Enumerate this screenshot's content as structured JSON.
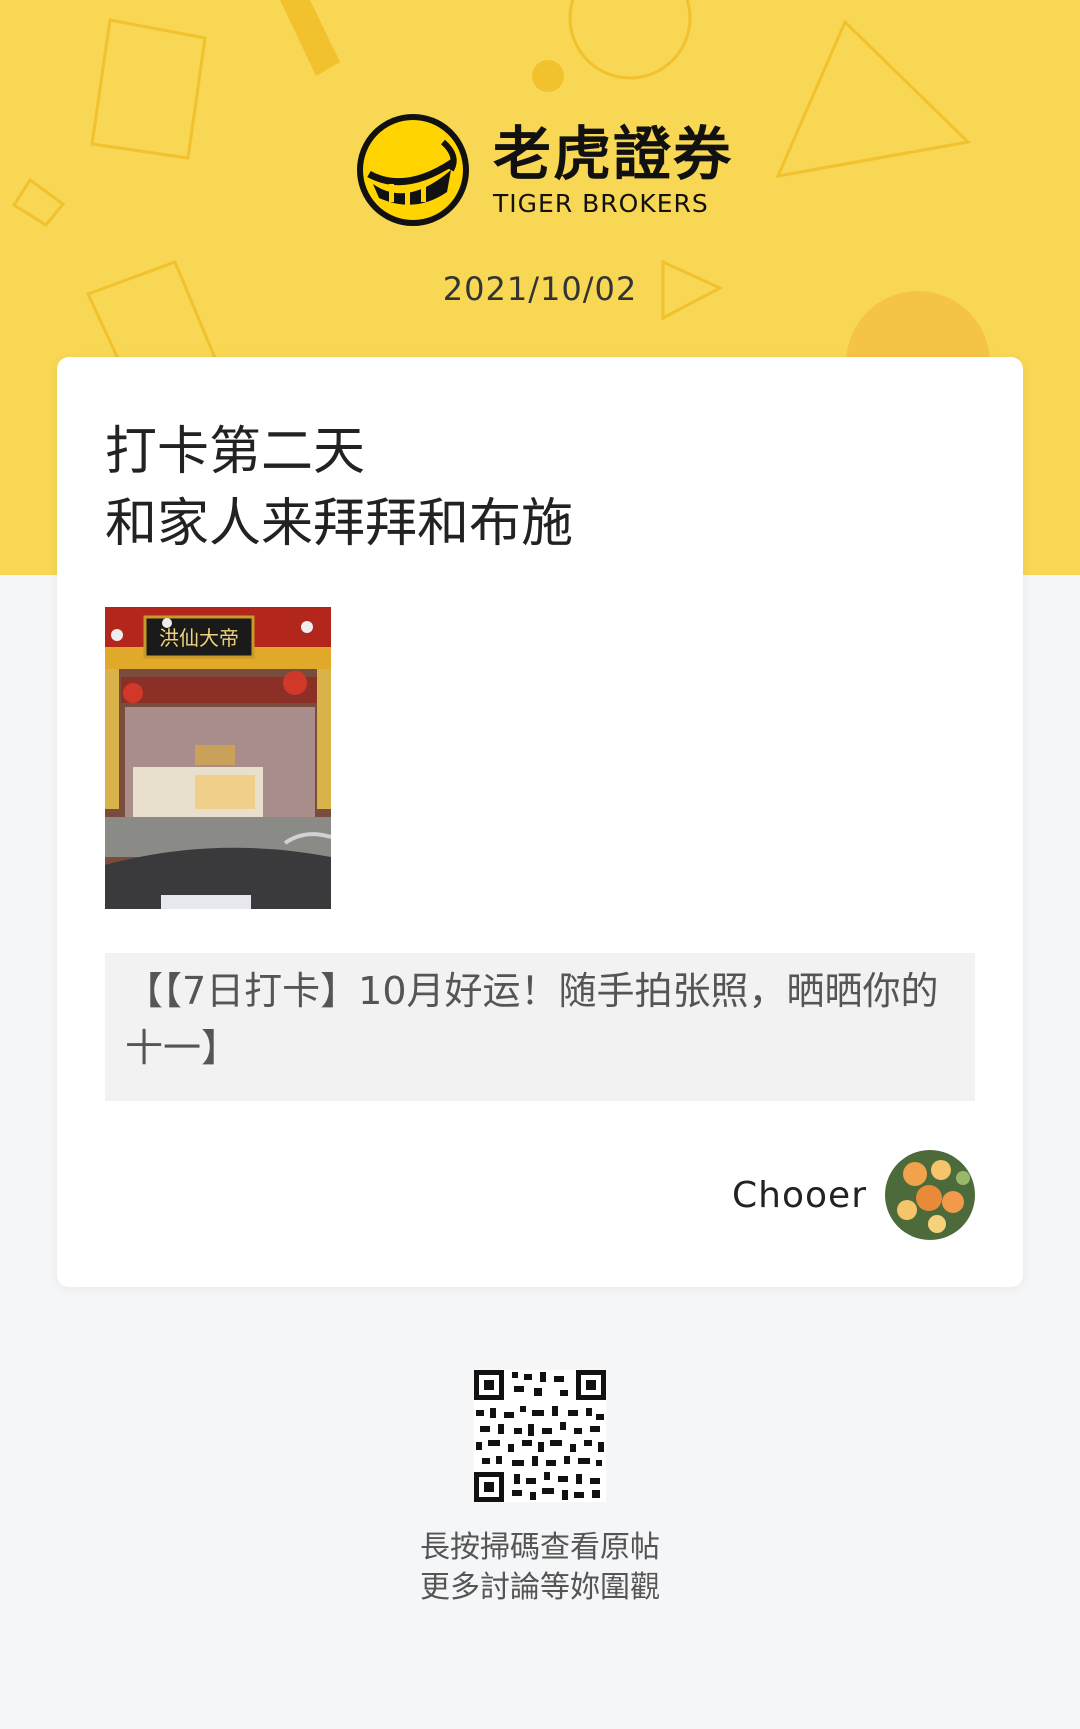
{
  "header": {
    "brand_cn": "老虎證券",
    "brand_en": "TIGER BROKERS",
    "date": "2021/10/02"
  },
  "post": {
    "line1": "打卡第二天",
    "line2": "和家人来拜拜和布施",
    "photo_sign": "洪仙大帝",
    "topic": "【【7日打卡】10月好运！随手拍张照，晒晒你的十一】"
  },
  "author": {
    "name": "Chooer"
  },
  "footer": {
    "caption_line1": "長按掃碼查看原帖",
    "caption_line2": "更多討論等妳圍觀"
  },
  "colors": {
    "brand_yellow": "#f7d753",
    "page_background": "#f5f6f8"
  }
}
